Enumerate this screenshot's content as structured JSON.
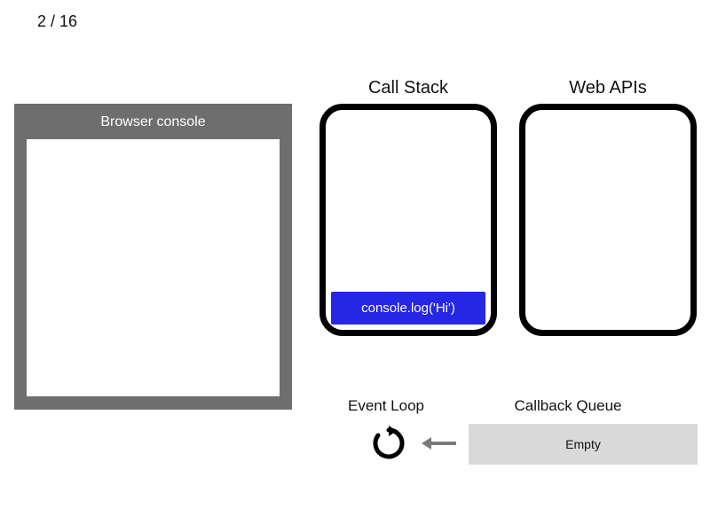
{
  "page_counter": "2 / 16",
  "console": {
    "title": "Browser console",
    "output": []
  },
  "headings": {
    "call_stack": "Call Stack",
    "web_apis": "Web APIs",
    "event_loop": "Event Loop",
    "callback_queue": "Callback Queue"
  },
  "call_stack": {
    "items": [
      "console.log('Hi')"
    ]
  },
  "web_apis": {
    "items": []
  },
  "callback_queue": {
    "empty_label": "Empty",
    "items": []
  },
  "colors": {
    "stack_item_bg": "#2626e5",
    "console_frame": "#6e6e6e",
    "queue_bg": "#d9d9d9"
  }
}
